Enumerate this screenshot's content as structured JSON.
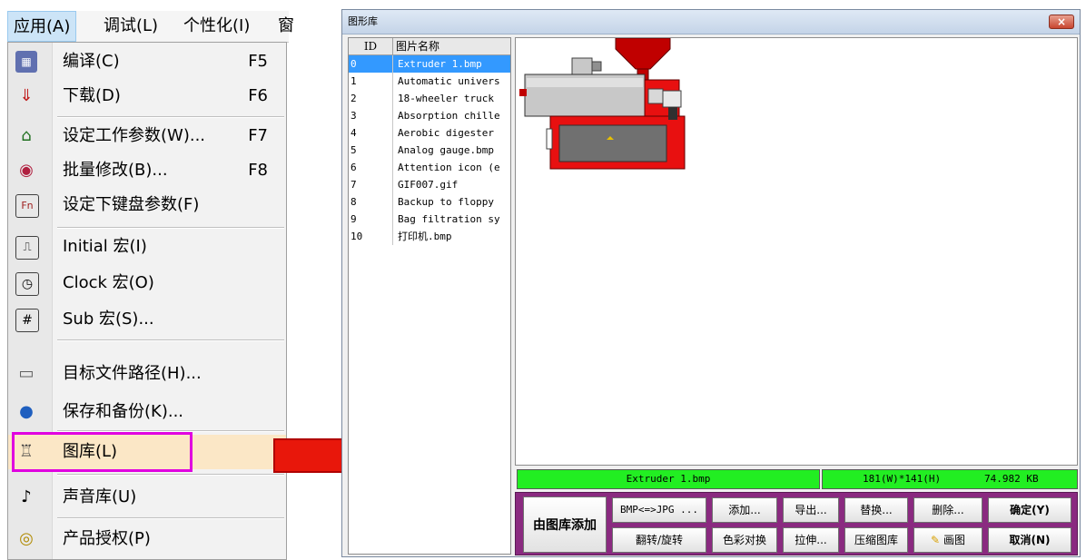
{
  "menubar": {
    "items": [
      "应用(A)",
      "调试(L)",
      "个性化(I)",
      "窗"
    ]
  },
  "menu": {
    "items": [
      {
        "label": "编译(C)",
        "shortcut": "F5",
        "icon": "compile-icon"
      },
      {
        "label": "下载(D)",
        "shortcut": "F6",
        "icon": "download-icon"
      },
      {
        "label": "设定工作参数(W)...",
        "shortcut": "F7",
        "icon": "home-settings-icon"
      },
      {
        "label": "批量修改(B)...",
        "shortcut": "F8",
        "icon": "batch-modify-icon"
      },
      {
        "label": "设定下键盘参数(F)",
        "shortcut": "",
        "icon": "fn-keyboard-icon"
      },
      {
        "label": "Initial 宏(I)",
        "shortcut": "",
        "icon": "initial-macro-icon"
      },
      {
        "label": "Clock 宏(O)",
        "shortcut": "",
        "icon": "clock-macro-icon"
      },
      {
        "label": "Sub 宏(S)...",
        "shortcut": "",
        "icon": "sub-macro-icon"
      },
      {
        "label": "目标文件路径(H)...",
        "shortcut": "",
        "icon": "drive-icon"
      },
      {
        "label": "保存和备份(K)...",
        "shortcut": "",
        "icon": "backup-icon"
      },
      {
        "label": "图库(L)",
        "shortcut": "",
        "icon": "gallery-icon"
      },
      {
        "label": "声音库(U)",
        "shortcut": "",
        "icon": "music-note-icon"
      },
      {
        "label": "产品授权(P)",
        "shortcut": "",
        "icon": "license-coins-icon"
      }
    ]
  },
  "gallery": {
    "title": "图形库",
    "close": "×",
    "columns": [
      "ID",
      "图片名称"
    ],
    "rows": [
      {
        "id": "0",
        "name": "Extruder 1.bmp"
      },
      {
        "id": "1",
        "name": "Automatic univers"
      },
      {
        "id": "2",
        "name": "18-wheeler truck"
      },
      {
        "id": "3",
        "name": "Absorption chille"
      },
      {
        "id": "4",
        "name": "Aerobic digester"
      },
      {
        "id": "5",
        "name": "Analog gauge.bmp"
      },
      {
        "id": "6",
        "name": "Attention icon (e"
      },
      {
        "id": "7",
        "name": "GIF007.gif"
      },
      {
        "id": "8",
        "name": "Backup to floppy"
      },
      {
        "id": "9",
        "name": "Bag filtration sy"
      },
      {
        "id": "10",
        "name": "打印机.bmp"
      }
    ],
    "status": {
      "filename": "Extruder 1.bmp",
      "dims": "181(W)*141(H)",
      "size": "74.982 KB"
    },
    "buttons": {
      "add_from_lib": "由图库添加",
      "bmp_jpg": "BMP<=>JPG ...",
      "add": "添加...",
      "export": "导出...",
      "replace": "替换...",
      "delete": "删除...",
      "ok": "确定(Y)",
      "flip_rotate": "翻转/旋转",
      "color_swap": "色彩对换",
      "stretch": "拉伸...",
      "compress": "压缩图库",
      "paint": "画图",
      "cancel": "取消(N)"
    }
  },
  "colors": {
    "highlight_border": "#e000e0",
    "arrow": "#e8170b",
    "status_green": "#22ee22",
    "button_panel": "#8a2a80",
    "selection": "#3399ff"
  }
}
